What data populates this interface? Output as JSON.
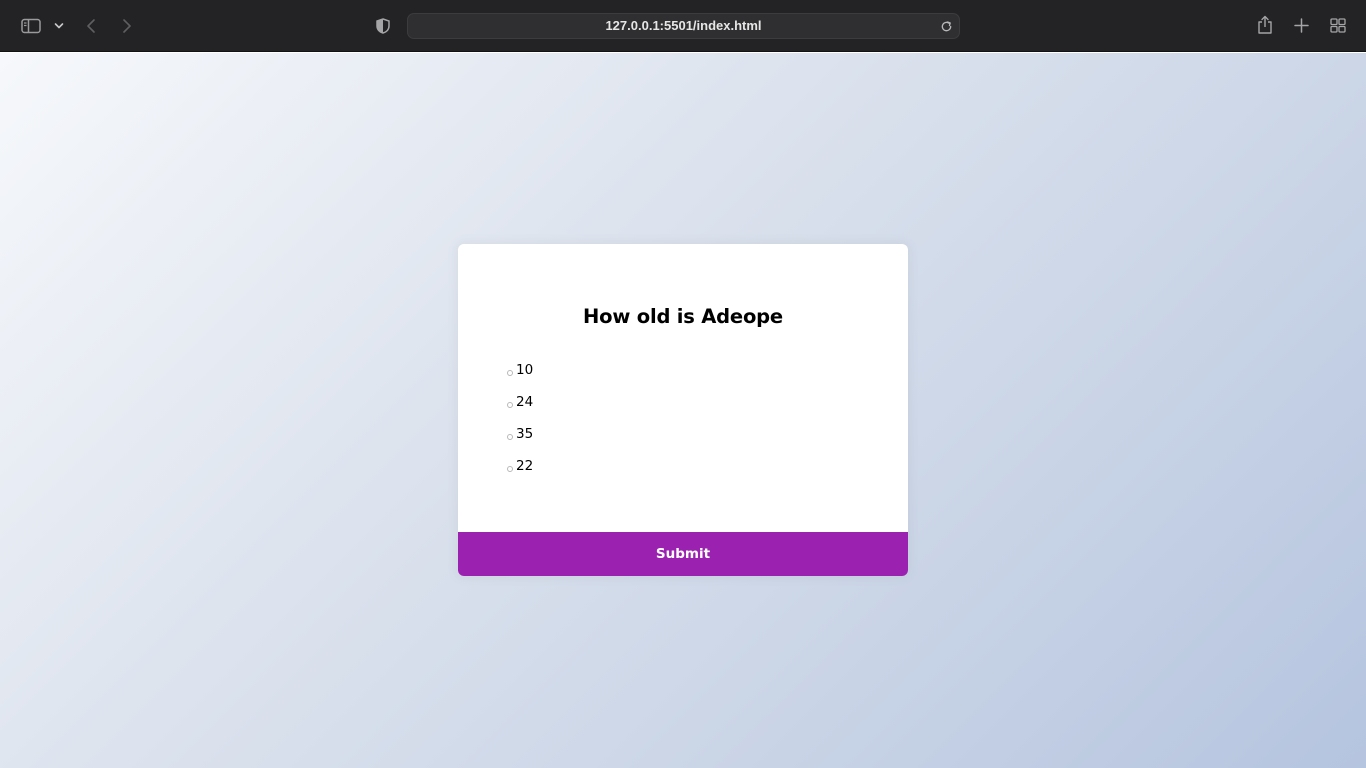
{
  "browser": {
    "url": "127.0.0.1:5501/index.html",
    "icons": [
      "sidebar-icon",
      "chevron-down-icon",
      "back-arrow-icon",
      "forward-arrow-icon",
      "shield-icon",
      "reload-icon",
      "share-icon",
      "new-tab-icon",
      "tab-overview-icon"
    ]
  },
  "quiz": {
    "question": "How old is Adeope",
    "answers": [
      {
        "label": "10"
      },
      {
        "label": "24"
      },
      {
        "label": "35"
      },
      {
        "label": "22"
      }
    ],
    "submit_label": "Submit"
  },
  "colors": {
    "accent": "#9b22b1",
    "toolbar": "#232325",
    "card": "#ffffff"
  }
}
